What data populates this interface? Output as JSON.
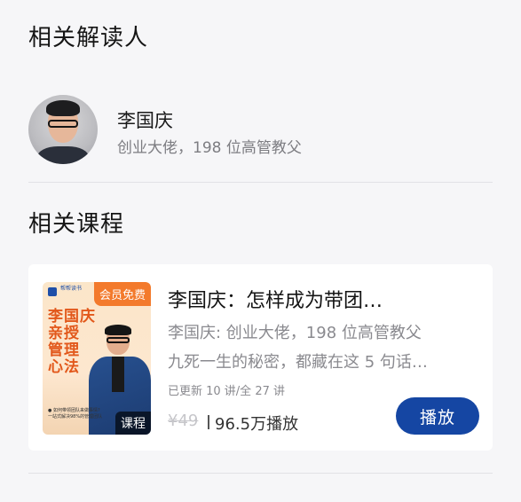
{
  "sections": {
    "readers_title": "相关解读人",
    "courses_title": "相关课程"
  },
  "reader": {
    "name": "李国庆",
    "description": "创业大佬，198 位高管教父"
  },
  "course": {
    "cover": {
      "logo_text": "帮帮读书",
      "vip_badge": "会员免费",
      "title_line1": "李国庆",
      "title_line2": "亲授",
      "title_line3": "管理",
      "title_line4": "心法",
      "bullet1": "● 如何带领团队来做事情?",
      "bullet2": "一站式解决98%的管理团队",
      "type_badge": "课程"
    },
    "title": "李国庆：怎样成为带团…",
    "subtitle1": "李国庆: 创业大佬，198 位高管教父",
    "subtitle2": "九死一生的秘密，都藏在这 5 句话…",
    "update_status": "已更新 10 讲/全 27 讲",
    "original_price": "¥49",
    "play_count": "96.5万播放",
    "play_button": "播放"
  },
  "colors": {
    "accent": "#1546a3",
    "vip_orange": "#f37a2c"
  }
}
